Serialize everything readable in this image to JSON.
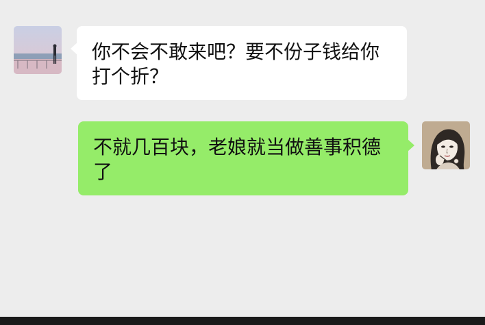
{
  "chat": {
    "messages": [
      {
        "sender": "contact",
        "text": "你不会不敢来吧？要不份子钱给你打个折？"
      },
      {
        "sender": "self",
        "text": "不就几百块，老娘就当做善事积德了"
      }
    ]
  },
  "colors": {
    "background": "#ededed",
    "incoming_bubble": "#ffffff",
    "outgoing_bubble": "#95ec69",
    "bottom_bar": "#1a1a1a"
  },
  "icons": {
    "contact_avatar": "seaside-person-avatar",
    "self_avatar": "sketch-woman-avatar"
  }
}
